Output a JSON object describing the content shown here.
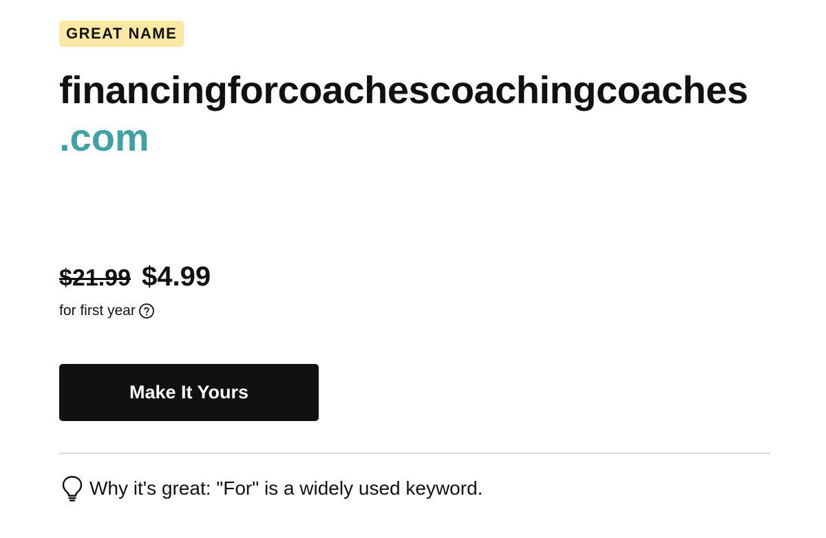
{
  "badge": {
    "label": "GREAT NAME",
    "color": "#fbe8a3"
  },
  "domain": {
    "name": "financingforcoachescoachingcoaches",
    "tld": ".com",
    "tld_color": "#3fa3a3"
  },
  "pricing": {
    "original_price": "$21.99",
    "sale_price": "$4.99",
    "term_note": "for first year",
    "help_icon": "question-circle-icon"
  },
  "cta": {
    "label": "Make It Yours"
  },
  "why": {
    "icon": "lightbulb-icon",
    "text": "Why it's great: \"For\" is a widely used keyword."
  }
}
